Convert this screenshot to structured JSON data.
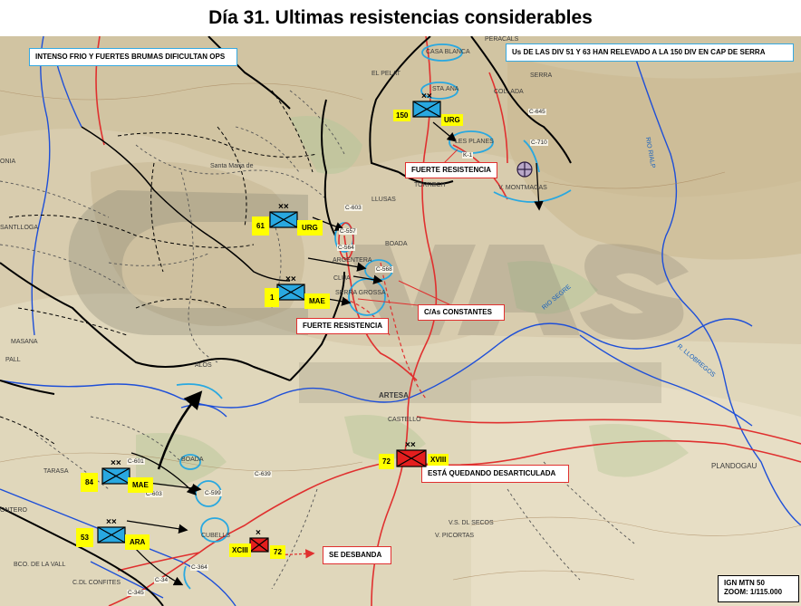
{
  "title": "Día 31. Ultimas resistencias considerables",
  "notes": {
    "weather": "INTENSO FRIO Y FUERTES BRUMAS DIFICULTAN OPS",
    "relief": "Us  DE LAS DIV 51 Y 63 HAN RELEVADO A LA 150 DIV EN CAP DE SERRA",
    "resistance_north": "FUERTE RESISTENCIA",
    "counterattacks": "C/As CONSTANTES",
    "resistance_center": "FUERTE RESISTENCIA",
    "disarticulating": "ESTÁ QUEDANDO DESARTICULADA",
    "disbanding": "SE DESBANDA",
    "scale_line1": "IGN MTN 50",
    "scale_line2": "ZOOM: 1/115.000"
  },
  "units": [
    {
      "id": "150",
      "tag": "URG",
      "size": "XX",
      "side": "nationalist"
    },
    {
      "id": "61",
      "tag": "URG",
      "size": "XX",
      "side": "nationalist"
    },
    {
      "id": "1",
      "tag": "MAE",
      "size": "XX",
      "side": "nationalist"
    },
    {
      "id": "84",
      "tag": "MAE",
      "size": "XX",
      "side": "nationalist"
    },
    {
      "id": "53",
      "tag": "ARA",
      "size": "XX",
      "side": "nationalist"
    },
    {
      "id": "72",
      "tag": "XVIII",
      "size": "XX",
      "side": "republican"
    },
    {
      "id": "XCIII",
      "tag": "72",
      "size": "X",
      "side": "republican"
    }
  ],
  "places": {
    "peracalls": "PERACALS",
    "casa_blanca": "CASA BLANCA",
    "el_pelat": "EL PELAT",
    "sta_ana": "STA.ANA",
    "collada": "COLLADA",
    "serra": "SERRA",
    "les_planes": "LES PLANES",
    "torrech": "TORRECH",
    "montmagas": "V. MONTMAGAS",
    "llusas": "LLUSAS",
    "boada": "BOADA",
    "argentera": "ARGENTERA",
    "clua": "CLUA",
    "serra_grossa": "SERRA GROSSA",
    "santllogar": "SANTLLOGA",
    "masana": "MASANA",
    "alos": "ALOS",
    "artesa": "ARTESA",
    "castello": "CASTELLO",
    "nonia": "ONIA",
    "tarasa": "TARASA",
    "ontero": "ONTERO",
    "cubells": "CUBELLS",
    "boada2": "BOADA",
    "vall": "BCO. DE LA VALL",
    "confites": "C.DL CONFITES",
    "plandogau": "PLANDOGAU",
    "picortas": "V. PICORTAS",
    "del_secos": "V.S. DL SECOS",
    "pall": "PALL",
    "santa_maria": "Santa Maria de"
  },
  "roads": {
    "c645": "C-645",
    "c710": "C-710",
    "k1": "K-1",
    "c603": "C-603",
    "c557": "C-557",
    "c564": "C-564",
    "c568": "C-568",
    "c601": "C-601",
    "c603b": "C-603",
    "c639": "C-639",
    "c599": "C-599",
    "c345": "C-345",
    "c344": "C-34",
    "c364": "C-364"
  },
  "rivers": {
    "rio_rialp": "RIO RIALP",
    "rio_segre": "RIO SEGRE",
    "llobregos": "R. LLOBREGOS"
  },
  "colors": {
    "nationalist_fill": "#29a8e0",
    "republican_fill": "#e41e1e",
    "label_bg": "#ffff00",
    "front_line": "#000000",
    "river": "#1e4fd8",
    "road": "#e0302f",
    "annotation_box_border_red": "#e0302f",
    "annotation_box_border_blue": "#36a9e1"
  },
  "icons": {
    "objective": "crosshair-circle-icon",
    "nationalist_unit": "infantry-division-symbol-icon",
    "republican_unit": "infantry-division-symbol-icon"
  }
}
